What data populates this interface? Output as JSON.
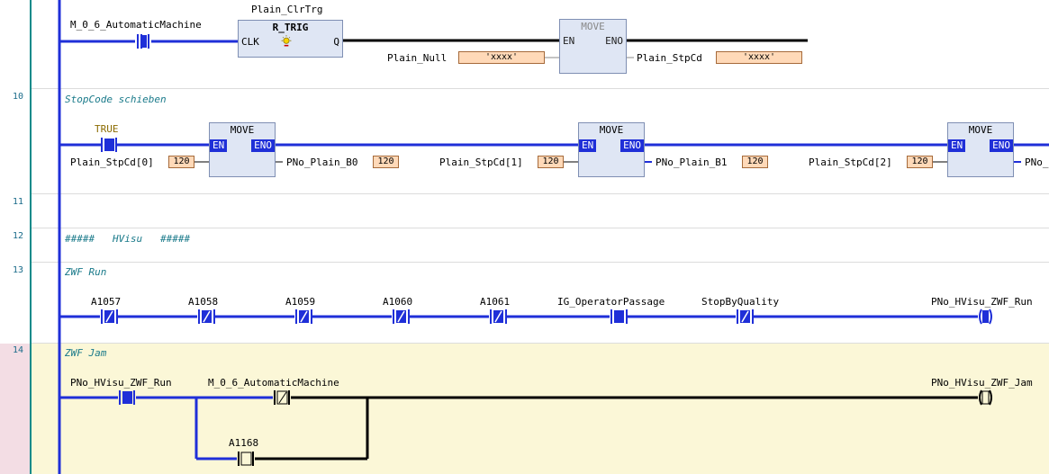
{
  "rungs": {
    "r9": {
      "contact_label": "M_0_6_AutomaticMachine",
      "fb_instance": "Plain_ClrTrg",
      "fb_type": "R_TRIG",
      "fb_in": "CLK",
      "fb_out": "Q",
      "move_title": "MOVE",
      "move_en": "EN",
      "move_eno": "ENO",
      "in_var": "Plain_Null",
      "in_val": "'xxxx'",
      "out_var": "Plain_StpCd",
      "out_val": "'xxxx'"
    },
    "r10": {
      "number": "10",
      "comment": "StopCode schieben",
      "contact_label": "TRUE",
      "moves": [
        {
          "title": "MOVE",
          "en": "EN",
          "eno": "ENO",
          "in_var": "Plain_StpCd[0]",
          "in_val": "120",
          "out_var": "PNo_Plain_B0",
          "out_val": "120"
        },
        {
          "title": "MOVE",
          "en": "EN",
          "eno": "ENO",
          "in_var": "Plain_StpCd[1]",
          "in_val": "120",
          "out_var": "PNo_Plain_B1",
          "out_val": "120"
        },
        {
          "title": "MOVE",
          "en": "EN",
          "eno": "ENO",
          "in_var": "Plain_StpCd[2]",
          "in_val": "120",
          "out_var": "PNo_"
        }
      ]
    },
    "r11": {
      "number": "11"
    },
    "r12": {
      "number": "12",
      "comment": "#####   HVisu   #####"
    },
    "r13": {
      "number": "13",
      "comment": "ZWF Run",
      "contacts": [
        "A1057",
        "A1058",
        "A1059",
        "A1060",
        "A1061",
        "IG_OperatorPassage",
        "StopByQuality"
      ],
      "coil": "PNo_HVisu_ZWF_Run"
    },
    "r14": {
      "number": "14",
      "comment": "ZWF Jam",
      "contact1": "PNo_HVisu_ZWF_Run",
      "contact2": "M_0_6_AutomaticMachine",
      "branch_contact": "A1168",
      "coil": "PNo_HVisu_ZWF_Jam"
    }
  },
  "colors": {
    "power": "#1f2fd8",
    "wire_false": "#000000",
    "selected_rung_bg": "#fbf7d7",
    "gutter_line": "#0a8a8a"
  }
}
